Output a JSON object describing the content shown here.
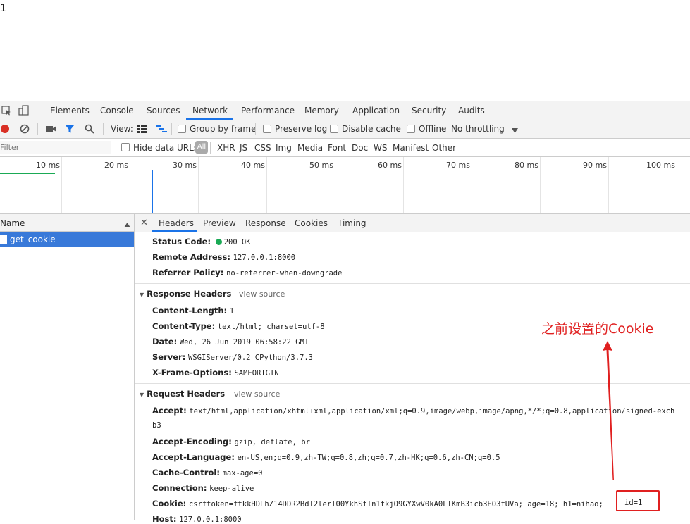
{
  "page": {
    "body_text": "1"
  },
  "devtools": {
    "main_tabs": [
      "Elements",
      "Console",
      "Sources",
      "Network",
      "Performance",
      "Memory",
      "Application",
      "Security",
      "Audits"
    ],
    "toolbar": {
      "view_label": "View:",
      "group_by_frame": "Group by frame",
      "preserve_log": "Preserve log",
      "disable_cache": "Disable cache",
      "offline": "Offline",
      "throttling": "No throttling"
    },
    "filter": {
      "placeholder": "Filter",
      "hide_data_urls": "Hide data URLs",
      "all": "All",
      "types": [
        "XHR",
        "JS",
        "CSS",
        "Img",
        "Media",
        "Font",
        "Doc",
        "WS",
        "Manifest",
        "Other"
      ]
    },
    "timeline": {
      "ticks": [
        "10 ms",
        "20 ms",
        "30 ms",
        "40 ms",
        "50 ms",
        "60 ms",
        "70 ms",
        "80 ms",
        "90 ms",
        "100 ms"
      ]
    },
    "request_list": {
      "name_header": "Name",
      "rows": [
        "get_cookie"
      ]
    },
    "detail_tabs": [
      "Headers",
      "Preview",
      "Response",
      "Cookies",
      "Timing"
    ],
    "general": [
      {
        "key": "Status Code:",
        "value": "200 OK"
      },
      {
        "key": "Remote Address:",
        "value": "127.0.0.1:8000"
      },
      {
        "key": "Referrer Policy:",
        "value": "no-referrer-when-downgrade"
      }
    ],
    "response_headers": {
      "title": "Response Headers",
      "view_source": "view source",
      "items": [
        {
          "key": "Content-Length:",
          "value": "1"
        },
        {
          "key": "Content-Type:",
          "value": "text/html; charset=utf-8"
        },
        {
          "key": "Date:",
          "value": "Wed, 26 Jun 2019 06:58:22 GMT"
        },
        {
          "key": "Server:",
          "value": "WSGIServer/0.2 CPython/3.7.3"
        },
        {
          "key": "X-Frame-Options:",
          "value": "SAMEORIGIN"
        }
      ]
    },
    "request_headers": {
      "title": "Request Headers",
      "view_source": "view source",
      "accept_key": "Accept:",
      "accept_value": "text/html,application/xhtml+xml,application/xml;q=0.9,image/webp,image/apng,*/*;q=0.8,application/signed-exch",
      "accept_wrap": "b3",
      "items": [
        {
          "key": "Accept-Encoding:",
          "value": "gzip, deflate, br"
        },
        {
          "key": "Accept-Language:",
          "value": "en-US,en;q=0.9,zh-TW;q=0.8,zh;q=0.7,zh-HK;q=0.6,zh-CN;q=0.5"
        },
        {
          "key": "Cache-Control:",
          "value": "max-age=0"
        },
        {
          "key": "Connection:",
          "value": "keep-alive"
        }
      ],
      "cookie_key": "Cookie:",
      "cookie_value": "csrftoken=ftkkHDLhZ14DDR2BdI2lerI00YkhSfTn1tkjO9GYXwV0kA0LTKmB3icb3EO3fUVa; age=18; h1=nihao;",
      "cookie_id": "id=1",
      "host_key": "Host:",
      "host_value": "127.0.0.1:8000"
    }
  },
  "annotation": {
    "text": "之前设置的Cookie",
    "color": "#e02020"
  }
}
